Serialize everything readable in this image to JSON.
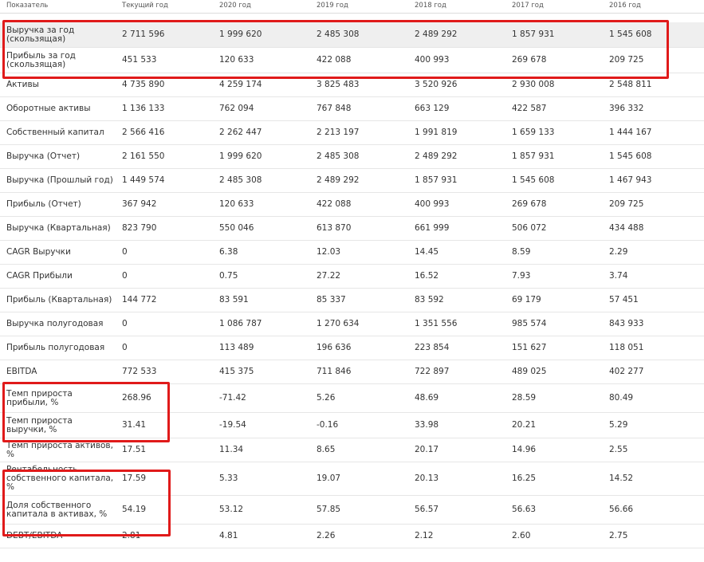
{
  "header": [
    "Показатель",
    "Текущий год",
    "2020 год",
    "2019 год",
    "2018 год",
    "2017 год",
    "2016 год"
  ],
  "rows": [
    {
      "label": "Выручка за год (скользящая)",
      "values": [
        "2 711 596",
        "1 999 620",
        "2 485 308",
        "2 489 292",
        "1 857 931",
        "1 545 608"
      ]
    },
    {
      "label": "Прибыль за год (скользящая)",
      "values": [
        "451 533",
        "120 633",
        "422 088",
        "400 993",
        "269 678",
        "209 725"
      ]
    },
    {
      "label": "Активы",
      "values": [
        "4 735 890",
        "4 259 174",
        "3 825 483",
        "3 520 926",
        "2 930 008",
        "2 548 811"
      ]
    },
    {
      "label": "Оборотные активы",
      "values": [
        "1 136 133",
        "762 094",
        "767 848",
        "663 129",
        "422 587",
        "396 332"
      ]
    },
    {
      "label": "Собственный капитал",
      "values": [
        "2 566 416",
        "2 262 447",
        "2 213 197",
        "1 991 819",
        "1 659 133",
        "1 444 167"
      ]
    },
    {
      "label": "Выручка (Отчет)",
      "values": [
        "2 161 550",
        "1 999 620",
        "2 485 308",
        "2 489 292",
        "1 857 931",
        "1 545 608"
      ]
    },
    {
      "label": "Выручка (Прошлый год)",
      "values": [
        "1 449 574",
        "2 485 308",
        "2 489 292",
        "1 857 931",
        "1 545 608",
        "1 467 943"
      ]
    },
    {
      "label": "Прибыль (Отчет)",
      "values": [
        "367 942",
        "120 633",
        "422 088",
        "400 993",
        "269 678",
        "209 725"
      ]
    },
    {
      "label": "Выручка (Квартальная)",
      "values": [
        "823 790",
        "550 046",
        "613 870",
        "661 999",
        "506 072",
        "434 488"
      ]
    },
    {
      "label": "CAGR Выручки",
      "values": [
        "0",
        "6.38",
        "12.03",
        "14.45",
        "8.59",
        "2.29"
      ]
    },
    {
      "label": "CAGR Прибыли",
      "values": [
        "0",
        "0.75",
        "27.22",
        "16.52",
        "7.93",
        "3.74"
      ]
    },
    {
      "label": "Прибыль (Квартальная)",
      "values": [
        "144 772",
        "83 591",
        "85 337",
        "83 592",
        "69 179",
        "57 451"
      ]
    },
    {
      "label": "Выручка полугодовая",
      "values": [
        "0",
        "1 086 787",
        "1 270 634",
        "1 351 556",
        "985 574",
        "843 933"
      ]
    },
    {
      "label": "Прибыль полугодовая",
      "values": [
        "0",
        "113 489",
        "196 636",
        "223 854",
        "151 627",
        "118 051"
      ]
    },
    {
      "label": "EBITDA",
      "values": [
        "772 533",
        "415 375",
        "711 846",
        "722 897",
        "489 025",
        "402 277"
      ]
    },
    {
      "label": "Темп прироста прибыли, %",
      "values": [
        "268.96",
        "-71.42",
        "5.26",
        "48.69",
        "28.59",
        "80.49"
      ]
    },
    {
      "label": "Темп прироста выручки, %",
      "values": [
        "31.41",
        "-19.54",
        "-0.16",
        "33.98",
        "20.21",
        "5.29"
      ]
    },
    {
      "label": "Темп прироста активов, %",
      "values": [
        "17.51",
        "11.34",
        "8.65",
        "20.17",
        "14.96",
        "2.55"
      ]
    },
    {
      "label": "Рентабельность собственного капитала, %",
      "values": [
        "17.59",
        "5.33",
        "19.07",
        "20.13",
        "16.25",
        "14.52"
      ]
    },
    {
      "label": "Доля собственного капитала в активах, %",
      "values": [
        "54.19",
        "53.12",
        "57.85",
        "56.57",
        "56.63",
        "56.66"
      ]
    },
    {
      "label": "DEBT/EBITDA",
      "values": [
        "2.81",
        "4.81",
        "2.26",
        "2.12",
        "2.60",
        "2.75"
      ]
    }
  ],
  "colors": {
    "highlight_box": "#e01a1a",
    "highlight_row": "#efefef",
    "text": "#333333"
  }
}
